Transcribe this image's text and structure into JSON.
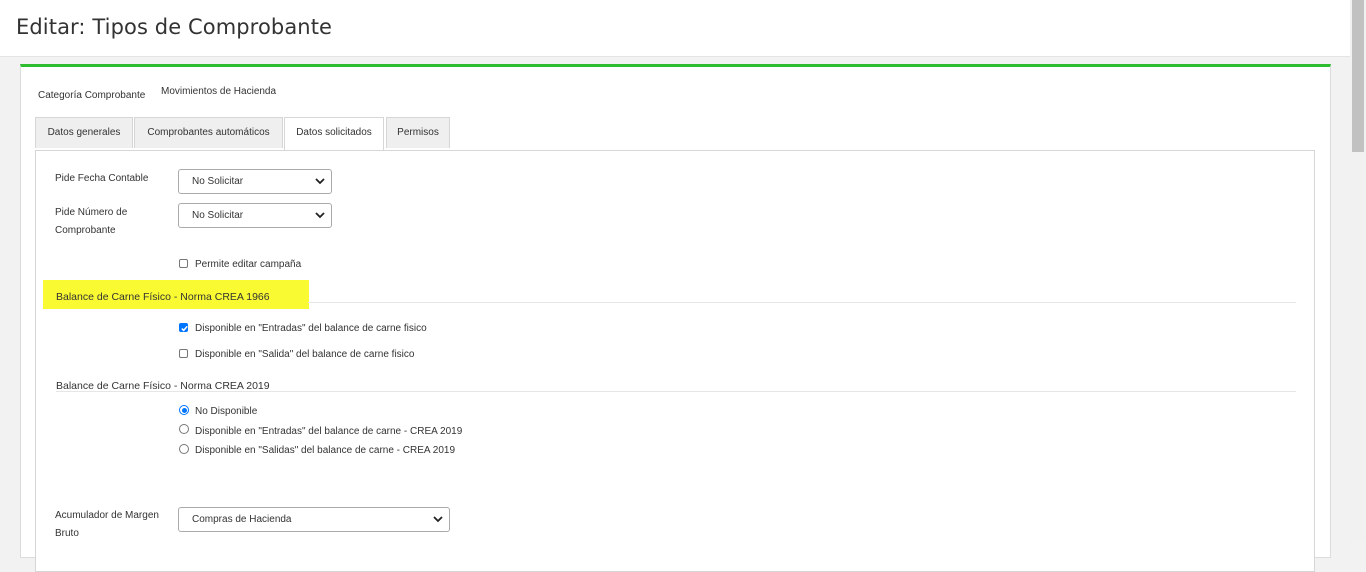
{
  "header": {
    "title": "Editar: Tipos de Comprobante"
  },
  "category": {
    "label": "Categoría Comprobante",
    "value": "Movimientos de Hacienda"
  },
  "tabs": [
    {
      "label": "Datos generales",
      "active": false
    },
    {
      "label": "Comprobantes automáticos",
      "active": false
    },
    {
      "label": "Datos solicitados",
      "active": true
    },
    {
      "label": "Permisos",
      "active": false
    }
  ],
  "form": {
    "fecha_contable": {
      "label": "Pide Fecha Contable",
      "value": "No Solicitar"
    },
    "numero_comprobante": {
      "label_line1": "Pide Número de",
      "label_line2": "Comprobante",
      "value": "No Solicitar"
    },
    "editar_campana": {
      "label": "Permite editar campaña",
      "checked": false
    }
  },
  "section1966": {
    "title": "Balance de Carne Físico - Norma CREA 1966",
    "highlight_color": "#fafa32",
    "options": [
      {
        "label": "Disponible en \"Entradas\" del balance de carne fisico",
        "checked": true
      },
      {
        "label": "Disponible en \"Salida\" del balance de carne fisico",
        "checked": false
      }
    ]
  },
  "section2019": {
    "title": "Balance de Carne Físico - Norma CREA 2019",
    "options": [
      {
        "label": "No Disponible",
        "selected": true
      },
      {
        "label": "Disponible en \"Entradas\" del balance de carne - CREA 2019",
        "selected": false
      },
      {
        "label": "Disponible en \"Salidas\" del balance de carne - CREA 2019",
        "selected": false
      }
    ]
  },
  "margen": {
    "label_line1": "Acumulador de Margen",
    "label_line2": "Bruto",
    "value": "Compras de Hacienda"
  },
  "colors": {
    "accent": "#2ebd2e",
    "checkbox": "#0075ff"
  }
}
